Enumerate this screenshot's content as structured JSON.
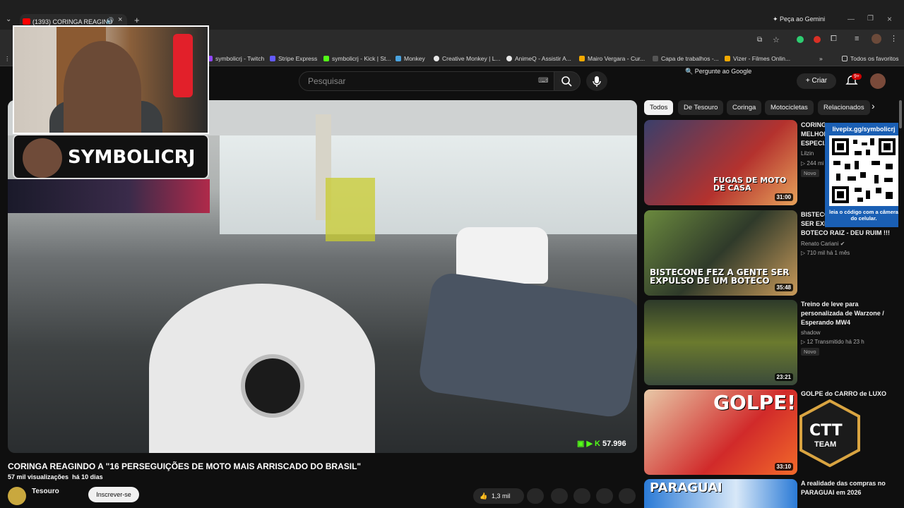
{
  "browser": {
    "tab_title": "(1393) CORINGA REAGIND",
    "gemini_label": "Peça ao Gemini",
    "pergunte_label": "Pergunte ao Google",
    "bookmarks": [
      {
        "label": "symbolicrj - Twitch",
        "color": "#9146ff"
      },
      {
        "label": "Stripe Express",
        "color": "#635bff"
      },
      {
        "label": "symbolicrj - Kick | St...",
        "color": "#53fc18"
      },
      {
        "label": "Monkey",
        "color": "#4aa3df"
      },
      {
        "label": "Creative Monkey | L...",
        "color": "#e8e8e8"
      },
      {
        "label": "AnimeQ - Assistir A...",
        "color": "#e8e8e8"
      },
      {
        "label": "Mairo Vergara - Cur...",
        "color": "#f2a900"
      },
      {
        "label": "Capa de trabalhos -...",
        "color": "#555555"
      },
      {
        "label": "Vizer - Filmes Onlin...",
        "color": "#f2a900"
      }
    ],
    "all_favorites": "Todos os favoritos"
  },
  "header": {
    "search_placeholder": "Pesquisar",
    "create_label": "Criar",
    "notif_count": "9+"
  },
  "overlay": {
    "streamer_name": "SYMBOLICRJ",
    "qr_url": "livepix.gg/symbolicrj",
    "qr_caption": "leia o código com a câmera do celular.",
    "ctt_logo": "CTT",
    "ctt_team": "TEAM"
  },
  "video": {
    "kick_viewers": "57.996",
    "title": "CORINGA REAGINDO A \"16 PERSEGUIÇÕES DE MOTO MAIS ARRISCADO DO BRASIL\"",
    "views": "57 mil visualizações",
    "age": "há 10 dias",
    "channel": "Tesouro",
    "subscribe_label": "Inscrever-se",
    "likes": "1,3 mil"
  },
  "chips": [
    "Todos",
    "De Tesouro",
    "Coringa",
    "Motocicletas",
    "Relacionados"
  ],
  "recommendations": [
    {
      "title": "CORINGA... MELHOR... ESPECI...",
      "channel": "Lilzin",
      "meta": "▷ 244 mi",
      "badge": "Novo",
      "duration": "31:00",
      "thumb_text": "FUGAS DE MOTO DE CASA"
    },
    {
      "title": "BISTECONE FEZ A GENTE SER EXPULSO DE UM BOTECO RAIZ - DEU RUIM !!!",
      "channel": "Renato Cariani",
      "meta": "▷ 710 mil  há 1 mês",
      "badge": "",
      "duration": "35:48",
      "thumb_text": "BISTECONE FEZ A GENTE SER EXPULSO DE UM BOTECO"
    },
    {
      "title": "Treino de leve para personalizada de Warzone / Esperando MW4",
      "channel": "shadow",
      "meta": "▷ 12  Transmitido há 23 h",
      "badge": "Novo",
      "duration": "23:21",
      "thumb_text": ""
    },
    {
      "title": "GOLPE do CARRO de LUXO",
      "channel": "",
      "meta": "",
      "badge": "",
      "duration": "33:10",
      "thumb_text": "GOLPE!"
    },
    {
      "title": "A realidade das compras no PARAGUAI em 2026",
      "channel": "",
      "meta": "",
      "badge": "",
      "duration": "",
      "thumb_text": "PARAGUAI"
    }
  ]
}
